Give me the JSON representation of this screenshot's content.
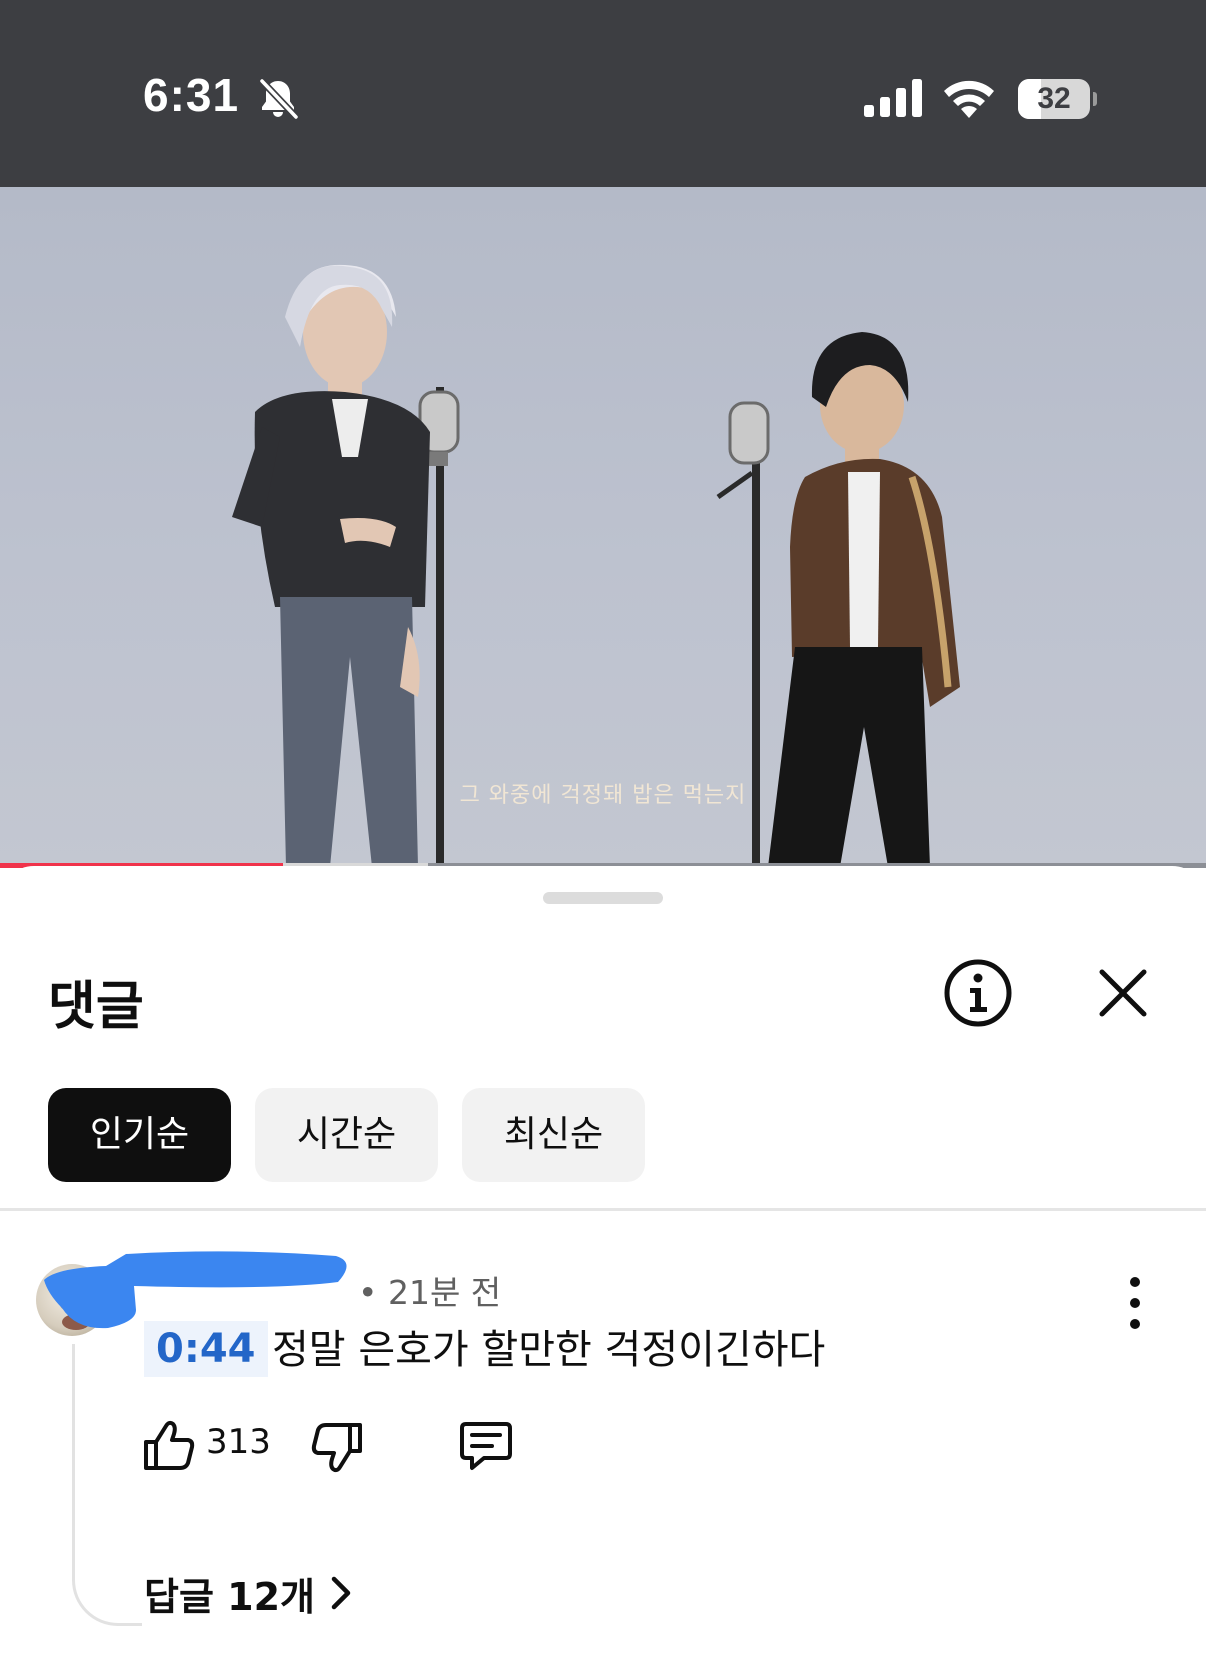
{
  "status_bar": {
    "time": "6:31",
    "battery_level": "32",
    "battery_fraction": 0.32,
    "icons": [
      "bell-slash-icon",
      "cellular-signal-icon",
      "wifi-icon",
      "battery-icon"
    ]
  },
  "video": {
    "subtitle": "그 와중에 걱정돼 밥은 먹는지",
    "progress_fraction": 0.235,
    "buffer_fraction": 0.355,
    "progress_color": "#f0334b"
  },
  "comments_panel": {
    "title": "댓글",
    "icons": [
      "info-icon",
      "close-icon"
    ],
    "sort_chips": [
      {
        "label": "인기순",
        "selected": true
      },
      {
        "label": "시간순",
        "selected": false
      },
      {
        "label": "최신순",
        "selected": false
      }
    ]
  },
  "comment": {
    "time_ago": "• 21분 전",
    "timestamp": "0:44",
    "text": "정말 은호가 할만한 걱정이긴하다",
    "like_count": "313",
    "replies_label": "답글 12개",
    "icons": [
      "thumbs-up-icon",
      "thumbs-down-icon",
      "reply-icon",
      "more-vertical-icon",
      "chevron-right-icon"
    ]
  },
  "colors": {
    "status_bar_bg": "#3d3e42",
    "timestamp_link": "#2366c8",
    "redaction": "#3b86f0",
    "chip_selected_bg": "#0f0f0f",
    "chip_unselected_bg": "#f2f2f2"
  }
}
